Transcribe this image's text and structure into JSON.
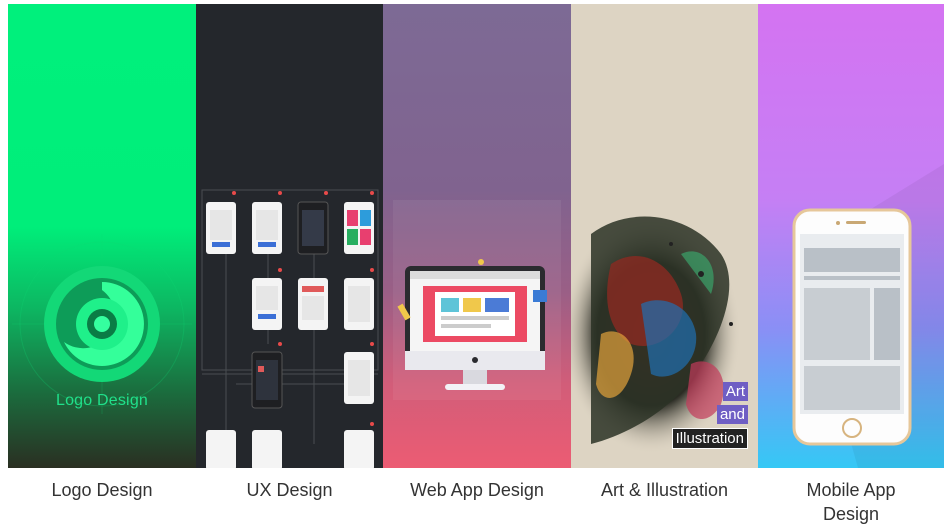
{
  "panels": [
    {
      "id": "logo",
      "caption": "Logo Design",
      "overlay_text": "Logo Design",
      "color": "#00f07c"
    },
    {
      "id": "ux",
      "caption": "UX Design",
      "color": "#24272c"
    },
    {
      "id": "webapp",
      "caption": "Web App Design",
      "color": "#ec5c73"
    },
    {
      "id": "art",
      "caption": "Art & Illustration",
      "overlay_lines": [
        "Art",
        "and",
        "Illustration"
      ],
      "color": "#ddd4c3"
    },
    {
      "id": "mobile",
      "caption_lines": [
        "Mobile App",
        "Design"
      ],
      "color": "#d473f2"
    }
  ],
  "icons": [
    "logo-swirl-icon",
    "wireframe-phones",
    "monitor-icon",
    "ink-splash-portrait",
    "smartphone-icon"
  ]
}
